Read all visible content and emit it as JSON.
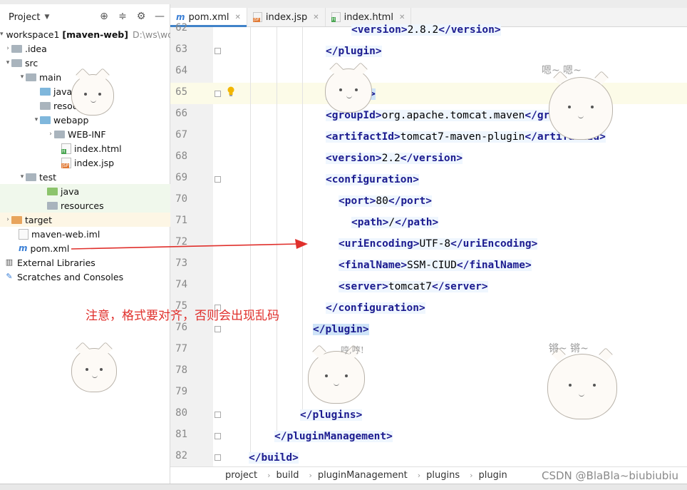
{
  "project_panel": {
    "title": "Project",
    "tree": [
      {
        "label": "workspace1",
        "suffix": "[maven-web]",
        "path": "D:\\ws\\wo"
      },
      {
        "label": ".idea"
      },
      {
        "label": "src"
      },
      {
        "label": "main"
      },
      {
        "label": "java"
      },
      {
        "label": "resources"
      },
      {
        "label": "webapp"
      },
      {
        "label": "WEB-INF"
      },
      {
        "label": "index.html"
      },
      {
        "label": "index.jsp"
      },
      {
        "label": "test"
      },
      {
        "label": "java"
      },
      {
        "label": "resources"
      },
      {
        "label": "target"
      },
      {
        "label": "maven-web.iml"
      },
      {
        "label": "pom.xml"
      },
      {
        "label": "External Libraries"
      },
      {
        "label": "Scratches and Consoles"
      }
    ]
  },
  "tabs": [
    {
      "label": "pom.xml",
      "active": true
    },
    {
      "label": "index.jsp",
      "active": false
    },
    {
      "label": "index.html",
      "active": false
    }
  ],
  "editor": {
    "line_numbers": [
      "62",
      "63",
      "64",
      "65",
      "66",
      "67",
      "68",
      "69",
      "70",
      "71",
      "72",
      "73",
      "74",
      "75",
      "76",
      "77",
      "78",
      "79",
      "80",
      "81",
      "82"
    ],
    "lines": [
      {
        "o": "<",
        "t": "version",
        "c": ">",
        "v": "2.8.2",
        "o2": "</",
        "t2": "version",
        "c2": ">"
      },
      {
        "o": "</",
        "t": "plugin",
        "c": ">"
      },
      {},
      {
        "o": "<",
        "t": "plugin",
        "c": ">"
      },
      {
        "o": "<",
        "t": "groupId",
        "c": ">",
        "v": "org.apache.tomcat.maven",
        "o2": "</",
        "t2": "groupId",
        "c2": ">"
      },
      {
        "o": "<",
        "t": "artifactId",
        "c": ">",
        "v": "tomcat7-maven-plugin",
        "o2": "</",
        "t2": "artifactId",
        "c2": ">"
      },
      {
        "o": "<",
        "t": "version",
        "c": ">",
        "v": "2.2",
        "o2": "</",
        "t2": "version",
        "c2": ">"
      },
      {
        "o": "<",
        "t": "configuration",
        "c": ">"
      },
      {
        "o": "<",
        "t": "port",
        "c": ">",
        "v": "80",
        "o2": "</",
        "t2": "port",
        "c2": ">"
      },
      {
        "o": "<",
        "t": "path",
        "c": ">",
        "v": "/",
        "o2": "</",
        "t2": "path",
        "c2": ">"
      },
      {
        "o": "<",
        "t": "uriEncoding",
        "c": ">",
        "v": "UTF-8",
        "o2": "</",
        "t2": "uriEncoding",
        "c2": ">"
      },
      {
        "o": "<",
        "t": "finalName",
        "c": ">",
        "v": "SSM-CIUD",
        "o2": "</",
        "t2": "finalName",
        "c2": ">"
      },
      {
        "o": "<",
        "t": "server",
        "c": ">",
        "v": "tomcat7",
        "o2": "</",
        "t2": "server",
        "c2": ">"
      },
      {
        "o": "</",
        "t": "configuration",
        "c": ">"
      },
      {
        "o": "</",
        "t": "plugin",
        "c": ">"
      },
      {},
      {},
      {},
      {
        "o": "</",
        "t": "plugins",
        "c": ">"
      },
      {
        "o": "</",
        "t": "pluginManagement",
        "c": ">"
      },
      {
        "o": "</",
        "t": "build",
        "c": ">"
      }
    ]
  },
  "breadcrumb": [
    "project",
    "build",
    "pluginManagement",
    "plugins",
    "plugin"
  ],
  "annotation": {
    "text": "注意，格式要对齐，否则会出现乱码",
    "color": "#e0302c"
  },
  "stickers": {
    "top_right": "嗯~  嗯~",
    "bottom_right": "锵~  锵~",
    "center": "哼,哼!"
  },
  "watermark": "CSDN @BlaBla~biubiubiu",
  "colors": {
    "tag": "#1b1b8f",
    "accent": "#4083c9",
    "highlight_line": "#fcfbe8"
  }
}
